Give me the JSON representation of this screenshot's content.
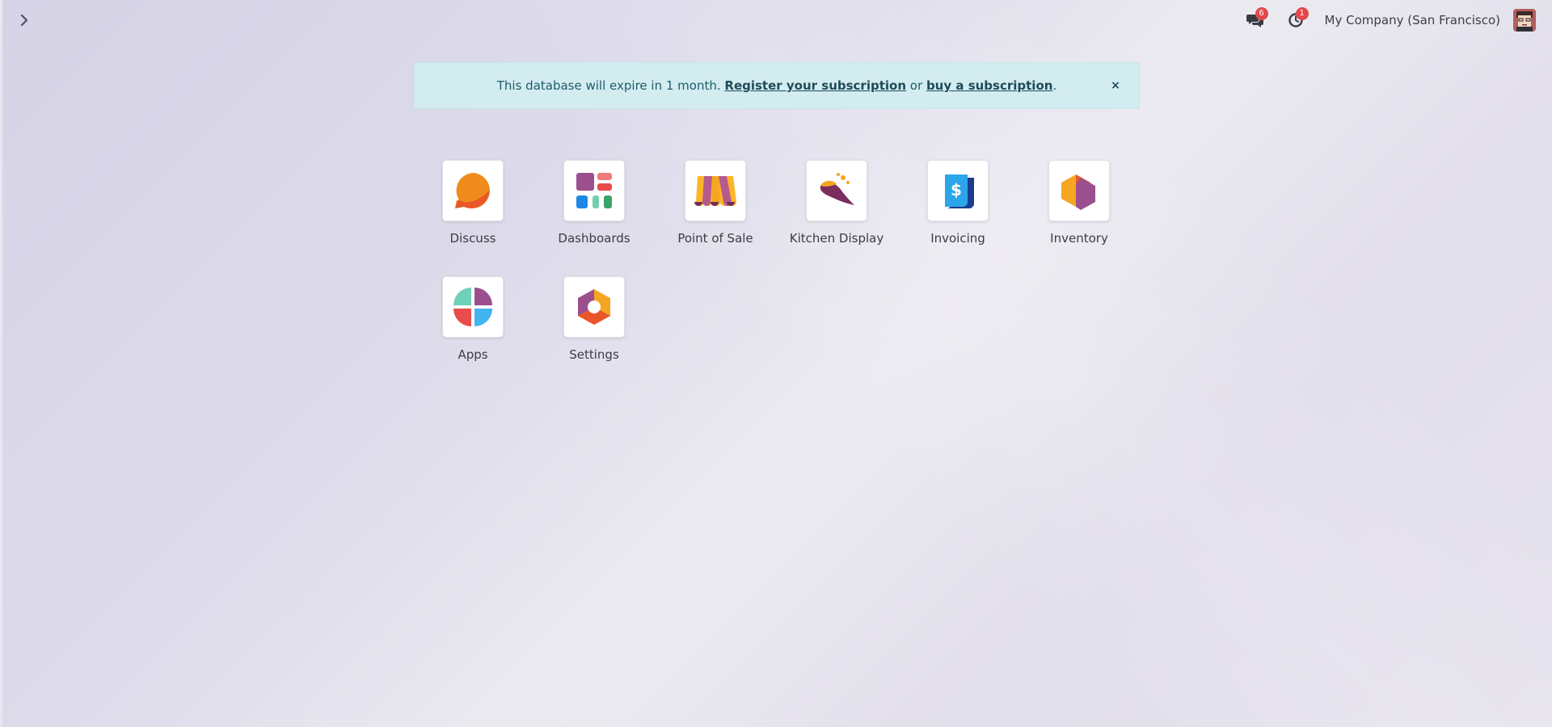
{
  "topbar": {
    "company": "My Company (San Francisco)",
    "messages_count": "6",
    "activities_count": "1"
  },
  "banner": {
    "text_before": "This database will expire in 1 month.",
    "register_link": "Register your subscription",
    "or_text": "or",
    "buy_link": "buy a subscription",
    "period": ".",
    "close_label": "×"
  },
  "apps": [
    {
      "label": "Discuss",
      "icon": "discuss-icon"
    },
    {
      "label": "Dashboards",
      "icon": "dashboards-icon"
    },
    {
      "label": "Point of Sale",
      "icon": "point-of-sale-icon"
    },
    {
      "label": "Kitchen Display",
      "icon": "kitchen-display-icon"
    },
    {
      "label": "Invoicing",
      "icon": "invoicing-icon"
    },
    {
      "label": "Inventory",
      "icon": "inventory-icon"
    },
    {
      "label": "Apps",
      "icon": "apps-icon"
    },
    {
      "label": "Settings",
      "icon": "settings-icon"
    }
  ],
  "colors": {
    "banner_bg": "#d3ecf0",
    "badge": "#e2484b",
    "text": "#3c3c44"
  }
}
